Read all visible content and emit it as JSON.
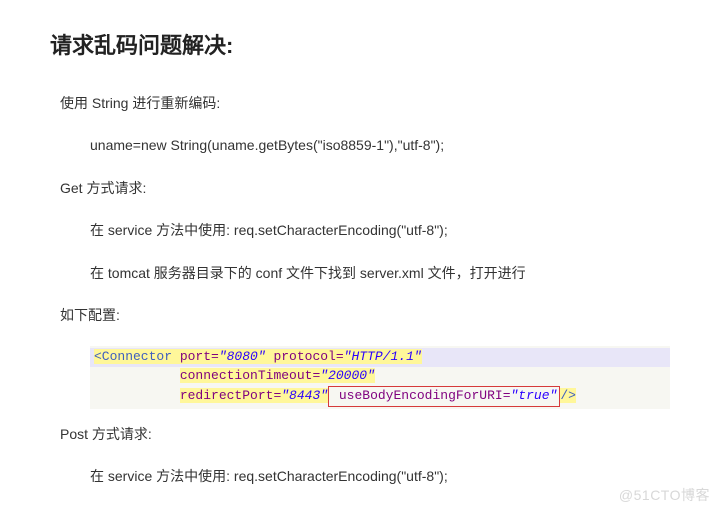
{
  "title": "请求乱码问题解决:",
  "p1": "使用 String 进行重新编码:",
  "p1_code": "uname=new String(uname.getBytes(\"iso8859-1\"),\"utf-8\");",
  "p2": "Get 方式请求:",
  "p2_line1": "在 service 方法中使用: req.setCharacterEncoding(\"utf-8\");",
  "p2_line2": "在 tomcat 服务器目录下的 conf 文件下找到 server.xml 文件，打开进行",
  "p3": "如下配置:",
  "code": {
    "tag_open": "<Connector",
    "port_name": " port=",
    "port_val": "\"8080\"",
    "proto_name": " protocol=",
    "proto_val": "\"HTTP/1.1\"",
    "ct_name": "connectionTimeout=",
    "ct_val": "\"20000\"",
    "rp_name": "redirectPort=",
    "rp_val": "\"8443\"",
    "enc_name": " useBodyEncodingForURI=",
    "enc_val": "\"true\"",
    "tag_close": "/>",
    "indent": "           "
  },
  "p4": "Post 方式请求:",
  "p4_line1": "在 service 方法中使用: req.setCharacterEncoding(\"utf-8\");",
  "watermark": "@51CTO博客"
}
